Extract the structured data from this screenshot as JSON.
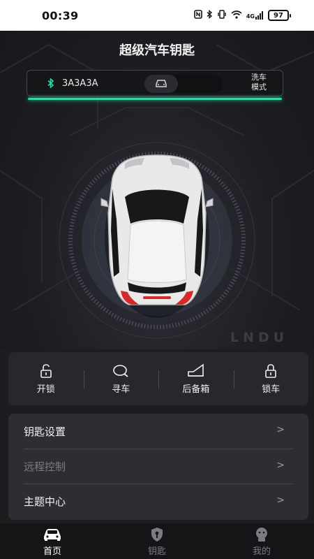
{
  "status_bar": {
    "time": "00:39",
    "icons": [
      "nfc-icon",
      "bluetooth-icon",
      "vibrate-icon",
      "wifi-icon",
      "signal-icon",
      "battery-icon"
    ],
    "signal_label": "4G",
    "battery": "97"
  },
  "header": {
    "title": "超级汽车钥匙"
  },
  "connection": {
    "device_name": "3A3A3A",
    "mode_label": "洗车\n模式",
    "accent_color": "#2fd6a6"
  },
  "brand_watermark": "LNDU",
  "quick_actions": [
    {
      "label": "开锁",
      "icon": "unlock-icon"
    },
    {
      "label": "寻车",
      "icon": "find-car-icon"
    },
    {
      "label": "后备箱",
      "icon": "trunk-icon"
    },
    {
      "label": "锁车",
      "icon": "lock-icon"
    }
  ],
  "menu": [
    {
      "label": "钥匙设置",
      "arrow": ">",
      "enabled": true
    },
    {
      "label": "远程控制",
      "arrow": ">",
      "enabled": false
    },
    {
      "label": "主题中心",
      "arrow": ">",
      "enabled": true
    }
  ],
  "bottom_nav": [
    {
      "label": "首页",
      "icon": "car-icon",
      "active": true
    },
    {
      "label": "钥匙",
      "icon": "shield-key-icon",
      "active": false
    },
    {
      "label": "我的",
      "icon": "profile-icon",
      "active": false
    }
  ]
}
